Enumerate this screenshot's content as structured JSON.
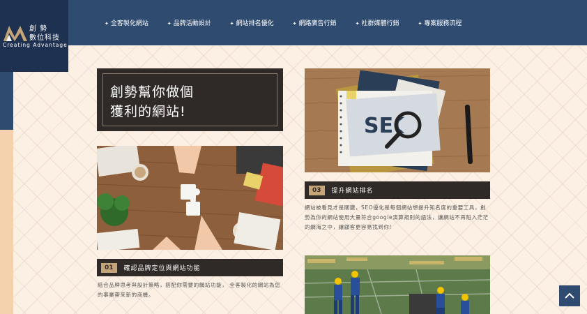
{
  "logo": {
    "line1": "創 勢",
    "line2": "數位科技",
    "tagline": "Creating  Advantage",
    "accent_color": "#c5a478"
  },
  "nav": {
    "items": [
      {
        "label": "全客製化網站"
      },
      {
        "label": "品牌活動設計"
      },
      {
        "label": "網站排名優化"
      },
      {
        "label": "網路廣告行銷"
      },
      {
        "label": "社群媒體行銷"
      },
      {
        "label": "專案服務流程"
      }
    ]
  },
  "hero": {
    "line1": "創勢幫你做個",
    "line2": "獲利的網站!"
  },
  "cards": [
    {
      "number": "01",
      "title": "確認品牌定位與網站功能",
      "desc": "結合品牌思考與設計策略，搭配你需要的網站功能， 全客製化的網站為您的事業帶來新的商機。"
    },
    {
      "number": "03",
      "title": "提升網站排名",
      "desc": "網站被看見才是關鍵，SEO優化是每個網站想提升知名度的重要工具，創勢為你的網站使用大量符合google演算規則的語法，讓網站不再陷入茫茫的網海之中，讓顧客更容易找到你!"
    }
  ],
  "seo_text": "SEO",
  "colors": {
    "header": "#2f4b70",
    "dark_box": "#2f2a27",
    "badge": "#c5a478",
    "background": "#fcefe3"
  },
  "icons": {
    "back_to_top": "chevron-up-icon"
  }
}
